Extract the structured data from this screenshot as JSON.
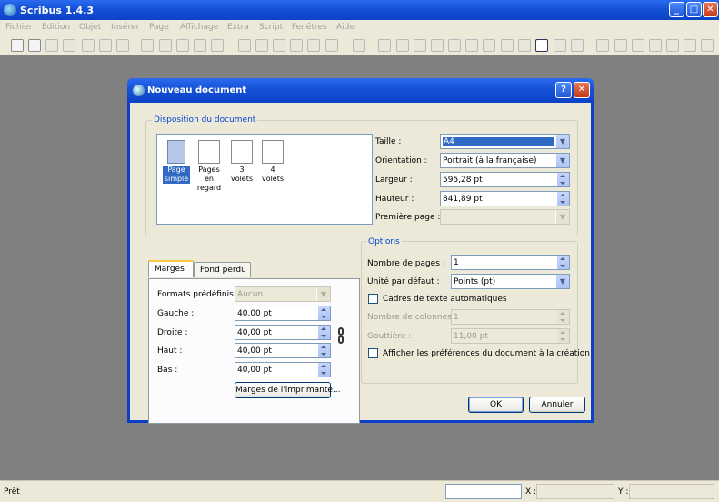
{
  "window": {
    "title": "Scribus 1.4.3",
    "controls": {
      "minimize": "_",
      "maximize": "□",
      "close": "✕"
    }
  },
  "menu": [
    "Fichier",
    "Édition",
    "Objet",
    "Insérer",
    "Page",
    "Affichage",
    "Extra",
    "Script",
    "Fenêtres",
    "Aide"
  ],
  "status": {
    "text": "Prêt",
    "x_label": "X :",
    "y_label": "Y :"
  },
  "dialog": {
    "title": "Nouveau document",
    "help_button": "?",
    "close_button": "✕",
    "layout_group": {
      "title": "Disposition du document",
      "options": [
        {
          "label": "Page simple",
          "selected": true
        },
        {
          "label": "Pages en regard",
          "selected": false
        },
        {
          "label": "3 volets",
          "selected": false
        },
        {
          "label": "4 volets",
          "selected": false
        }
      ],
      "fields": {
        "size_label": "Taille :",
        "size_value": "A4",
        "orientation_label": "Orientation :",
        "orientation_value": "Portrait (à la française)",
        "width_label": "Largeur :",
        "width_value": "595,28 pt",
        "height_label": "Hauteur :",
        "height_value": "841,89 pt",
        "first_page_label": "Première page :",
        "first_page_value": ""
      }
    },
    "tabs": {
      "margins_tab": "Marges",
      "bleed_tab": "Fond perdu",
      "preset_label": "Formats prédéfinis :",
      "preset_value": "Aucun",
      "left_label": "Gauche :",
      "left_value": "40,00 pt",
      "right_label": "Droite :",
      "right_value": "40,00 pt",
      "top_label": "Haut :",
      "top_value": "40,00 pt",
      "bottom_label": "Bas :",
      "bottom_value": "40,00 pt",
      "printer_margins_button": "Marges de l'imprimante..."
    },
    "options_group": {
      "title": "Options",
      "pages_label": "Nombre de pages :",
      "pages_value": "1",
      "unit_label": "Unité par défaut :",
      "unit_value": "Points (pt)",
      "auto_frames_label": "Cadres de texte automatiques",
      "auto_frames_checked": false,
      "columns_label": "Nombre de colonnes :",
      "columns_value": "1",
      "gutter_label": "Gouttière :",
      "gutter_value": "11,00 pt",
      "show_prefs_label": "Afficher les préférences du document à la création",
      "show_prefs_checked": false
    },
    "ok_button": "OK",
    "cancel_button": "Annuler"
  }
}
